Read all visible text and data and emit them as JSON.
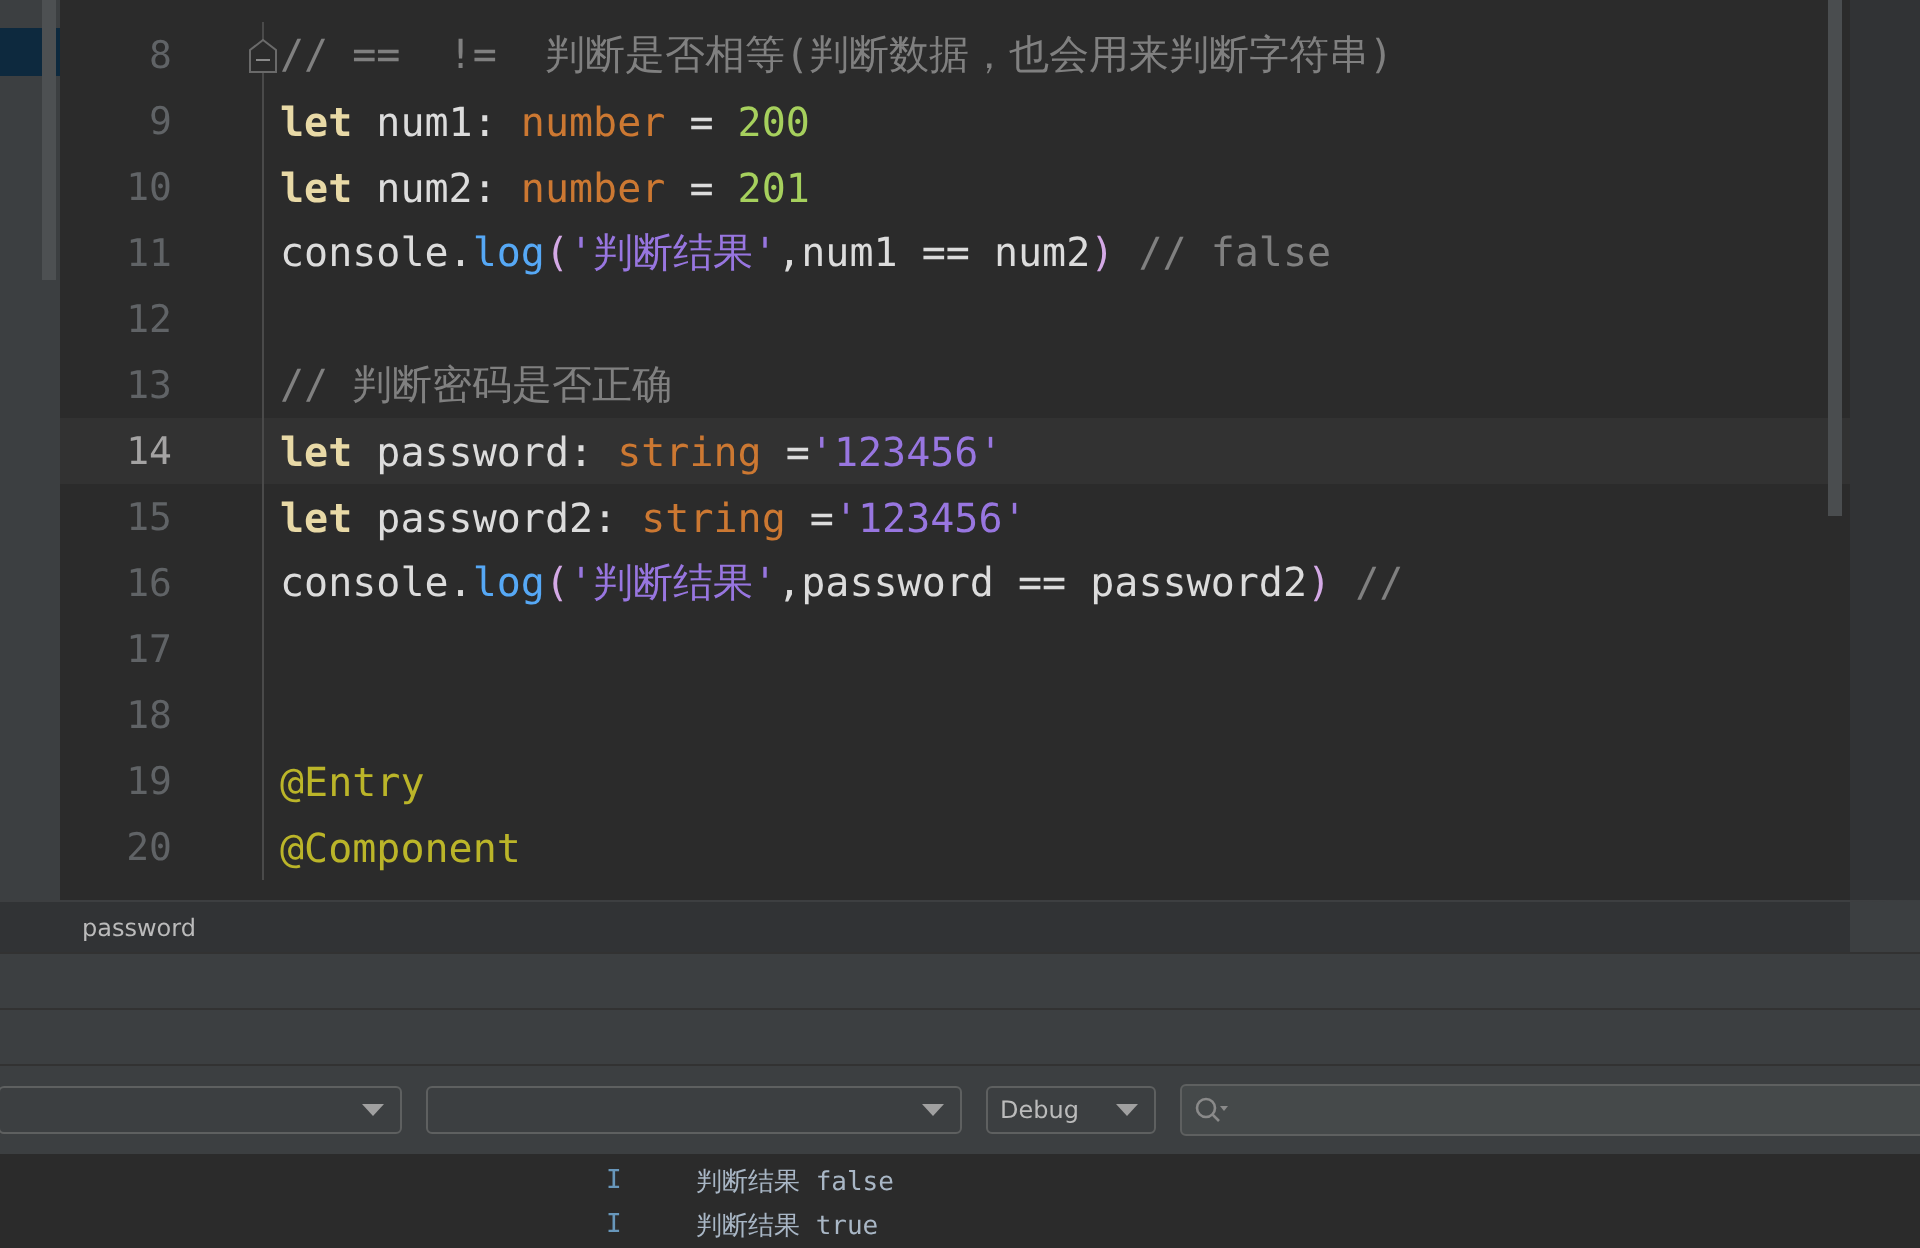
{
  "editor": {
    "lines": [
      {
        "number": "8",
        "current": false,
        "fold": true,
        "tokens": [
          {
            "kind": "comment",
            "text": "// ==  !=  判断是否相等(判断数据，也会用来判断字符串)"
          }
        ]
      },
      {
        "number": "9",
        "current": false,
        "fold": false,
        "tokens": [
          {
            "kind": "keyword",
            "text": "let"
          },
          {
            "kind": "plain",
            "text": " num1: "
          },
          {
            "kind": "type",
            "text": "number"
          },
          {
            "kind": "plain",
            "text": " = "
          },
          {
            "kind": "number",
            "text": "200"
          }
        ]
      },
      {
        "number": "10",
        "current": false,
        "fold": false,
        "tokens": [
          {
            "kind": "keyword",
            "text": "let"
          },
          {
            "kind": "plain",
            "text": " num2: "
          },
          {
            "kind": "type",
            "text": "number"
          },
          {
            "kind": "plain",
            "text": " = "
          },
          {
            "kind": "number",
            "text": "201"
          }
        ]
      },
      {
        "number": "11",
        "current": false,
        "fold": false,
        "tokens": [
          {
            "kind": "plain",
            "text": "console."
          },
          {
            "kind": "func",
            "text": "log"
          },
          {
            "kind": "paren",
            "text": "("
          },
          {
            "kind": "string",
            "text": "'判断结果'"
          },
          {
            "kind": "plain",
            "text": ",num1 == num2"
          },
          {
            "kind": "paren",
            "text": ")"
          },
          {
            "kind": "comment",
            "text": " // false"
          }
        ]
      },
      {
        "number": "12",
        "current": false,
        "fold": false
      },
      {
        "number": "13",
        "current": false,
        "fold": false,
        "tokens": [
          {
            "kind": "comment",
            "text": "// 判断密码是否正确"
          }
        ]
      },
      {
        "number": "14",
        "current": true,
        "fold": false,
        "tokens": [
          {
            "kind": "keyword",
            "text": "let"
          },
          {
            "kind": "plain",
            "text": " password: "
          },
          {
            "kind": "type",
            "text": "string"
          },
          {
            "kind": "plain",
            "text": " ="
          },
          {
            "kind": "string",
            "text": "'123456'"
          }
        ]
      },
      {
        "number": "15",
        "current": false,
        "fold": false,
        "tokens": [
          {
            "kind": "keyword",
            "text": "let"
          },
          {
            "kind": "plain",
            "text": " password2: "
          },
          {
            "kind": "type",
            "text": "string"
          },
          {
            "kind": "plain",
            "text": " ="
          },
          {
            "kind": "string",
            "text": "'123456'"
          }
        ]
      },
      {
        "number": "16",
        "current": false,
        "fold": false,
        "tokens": [
          {
            "kind": "plain",
            "text": "console."
          },
          {
            "kind": "func",
            "text": "log"
          },
          {
            "kind": "paren",
            "text": "("
          },
          {
            "kind": "string",
            "text": "'判断结果'"
          },
          {
            "kind": "plain",
            "text": ",password == password2"
          },
          {
            "kind": "paren",
            "text": ")"
          },
          {
            "kind": "comment",
            "text": " //"
          }
        ]
      },
      {
        "number": "17",
        "current": false,
        "fold": false
      },
      {
        "number": "18",
        "current": false,
        "fold": false
      },
      {
        "number": "19",
        "current": false,
        "fold": false,
        "tokens": [
          {
            "kind": "decorator",
            "text": "@Entry"
          }
        ]
      },
      {
        "number": "20",
        "current": false,
        "fold": false,
        "tokens": [
          {
            "kind": "decorator",
            "text": "@Component"
          }
        ]
      }
    ]
  },
  "breadcrumb": "password",
  "log_toolbar": {
    "log_level": "Debug"
  },
  "log_rows": [
    {
      "level": "I",
      "message": "判断结果 false"
    },
    {
      "level": "I",
      "message": "判断结果 true"
    }
  ]
}
